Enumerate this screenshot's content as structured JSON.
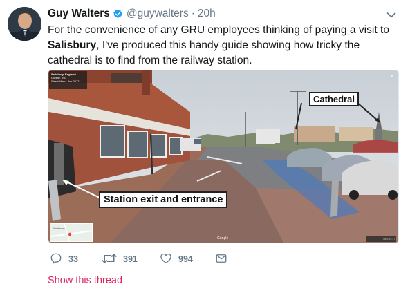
{
  "author": {
    "name": "Guy Walters",
    "handle": "@guywalters",
    "separator": "·",
    "timestamp": "20h",
    "verified": true
  },
  "tweet": {
    "text_before": "For the convenience of any GRU employees thinking of paying a visit to ",
    "text_bold": "Salisbury",
    "text_after": ", I've produced this handy guide showing how tricky the cathedral is to find from the railway station."
  },
  "media": {
    "streetview_title": "Salisbury, England",
    "streetview_sub1": "Google, Inc.",
    "streetview_sub2": "Street View - Jun 2017",
    "close_glyph": "×",
    "label_cathedral": "Cathedral",
    "label_station": "Station exit and entrance",
    "minimap_label": "Salisbury",
    "watermark": "Google",
    "bottom_bar": "▭ ◁ ▷ ◻"
  },
  "actions": {
    "reply_count": "33",
    "retweet_count": "391",
    "like_count": "994"
  },
  "show_thread": "Show this thread",
  "colors": {
    "verified_blue": "#1da1f2",
    "link_red": "#e0245e",
    "muted_gray": "#657786"
  },
  "icons": [
    "verified-badge-icon",
    "chevron-down-icon",
    "reply-icon",
    "retweet-icon",
    "like-icon",
    "direct-message-icon"
  ]
}
